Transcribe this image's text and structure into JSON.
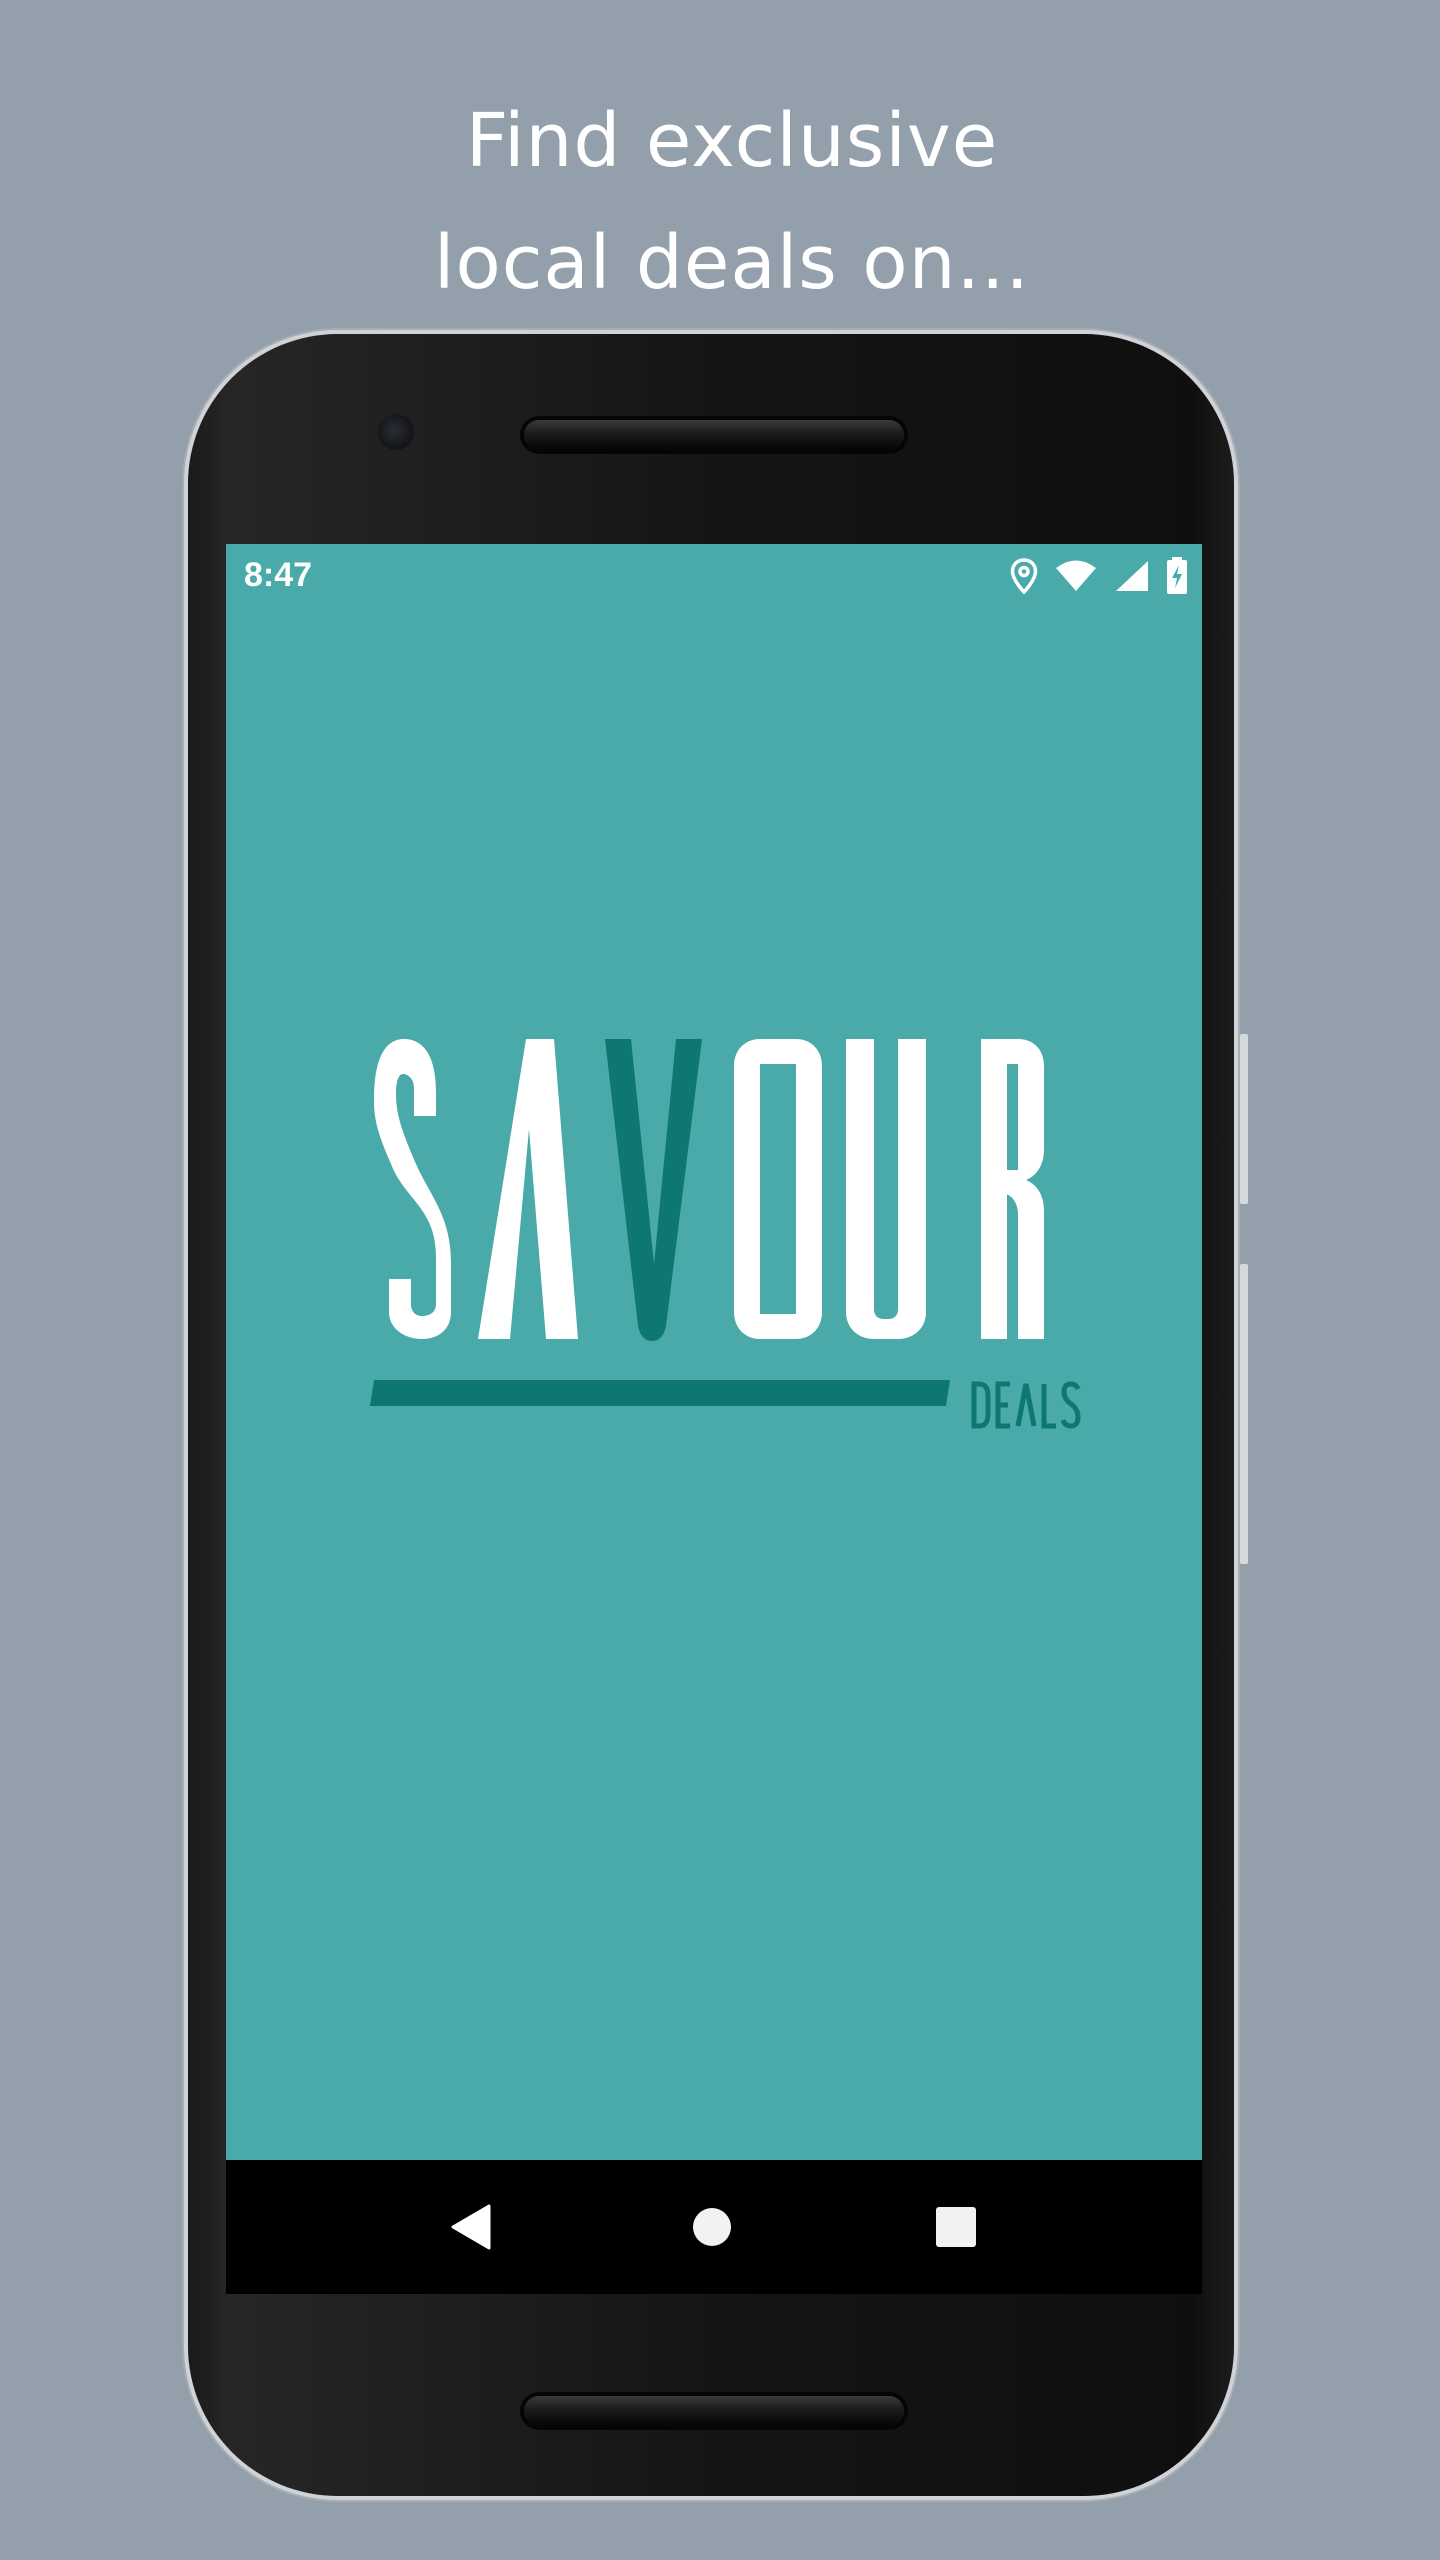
{
  "headline": {
    "line1": "Find exclusive",
    "line2": "local deals on..."
  },
  "status_bar": {
    "time": "8:47",
    "icons": [
      "location-icon",
      "wifi-icon",
      "signal-icon",
      "battery-charging-icon"
    ]
  },
  "logo": {
    "text": "SAVOUR",
    "subtext": "DEALS",
    "colors": {
      "primary": "#ffffff",
      "accent": "#0e7772"
    }
  },
  "nav_bar": {
    "buttons": [
      "back-icon",
      "home-icon",
      "recents-icon"
    ]
  },
  "colors": {
    "background": "#939fab",
    "screen": "#4aaaaa",
    "accent": "#0e7772"
  }
}
